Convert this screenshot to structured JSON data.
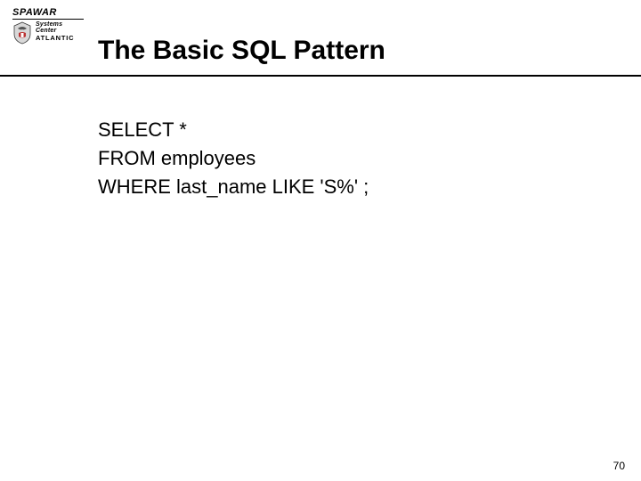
{
  "logo": {
    "brand": "SPAWAR",
    "line1a": "Systems",
    "line1b": "Center",
    "line2": "ATLANTIC"
  },
  "title": "The Basic SQL Pattern",
  "sql": {
    "line1": "SELECT *",
    "line2": "FROM employees",
    "line3": "WHERE last_name  LIKE 'S%' ;"
  },
  "page_number": "70"
}
